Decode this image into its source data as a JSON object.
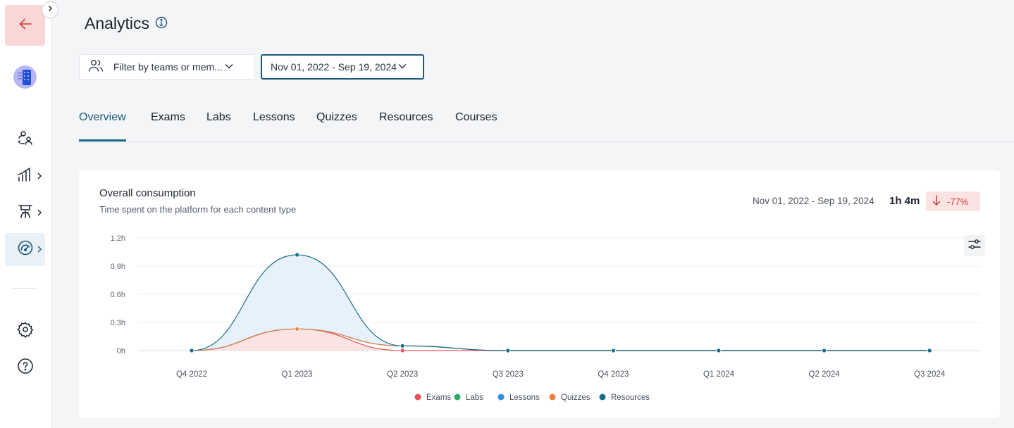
{
  "page": {
    "title": "Analytics"
  },
  "filters": {
    "teams_placeholder": "Filter by teams or mem...",
    "date_range": "Nov 01, 2022 - Sep 19, 2024"
  },
  "tabs": [
    {
      "label": "Overview",
      "active": true
    },
    {
      "label": "Exams",
      "active": false
    },
    {
      "label": "Labs",
      "active": false
    },
    {
      "label": "Lessons",
      "active": false
    },
    {
      "label": "Quizzes",
      "active": false
    },
    {
      "label": "Resources",
      "active": false
    },
    {
      "label": "Courses",
      "active": false
    }
  ],
  "card": {
    "title": "Overall consumption",
    "subtitle": "Time spent on the platform for each content type",
    "date_range": "Nov 01, 2022 - Sep 19, 2024",
    "total": "1h 4m",
    "delta": "-77%"
  },
  "colors": {
    "accent": "#1b5a7a",
    "negative": "#c83d3a",
    "back_button_bg": "#f8d7d6"
  },
  "icons": {
    "back": "arrow-left-icon",
    "collapse": "chevron-right-icon",
    "nav": [
      "users-icon",
      "chart-bars-icon",
      "classroom-icon",
      "gauge-icon",
      "gear-icon",
      "help-icon"
    ]
  },
  "chart_data": {
    "type": "area",
    "categories": [
      "Q4 2022",
      "Q1 2023",
      "Q2 2023",
      "Q3 2023",
      "Q4 2023",
      "Q1 2024",
      "Q2 2024",
      "Q3 2024"
    ],
    "yticks": [
      "0h",
      "0.3h",
      "0.6h",
      "0.9h",
      "1.2h"
    ],
    "ylim": [
      0,
      1.2
    ],
    "grid": true,
    "legend_position": "bottom",
    "series": [
      {
        "name": "Exams",
        "color": "#e8525a",
        "values": [
          0,
          0.23,
          0,
          0,
          0,
          0,
          0,
          0
        ]
      },
      {
        "name": "Labs",
        "color": "#2ea86a",
        "values": [
          0,
          0,
          0.05,
          0,
          0,
          0,
          0,
          0
        ]
      },
      {
        "name": "Lessons",
        "color": "#2f8fe0",
        "values": [
          0,
          0,
          0,
          0,
          0,
          0,
          0,
          0
        ]
      },
      {
        "name": "Quizzes",
        "color": "#f08040",
        "values": [
          0,
          0,
          0,
          0,
          0,
          0,
          0,
          0
        ]
      },
      {
        "name": "Resources",
        "color": "#1a6c87",
        "values": [
          0,
          0.79,
          0,
          0,
          0,
          0,
          0,
          0
        ]
      }
    ]
  }
}
